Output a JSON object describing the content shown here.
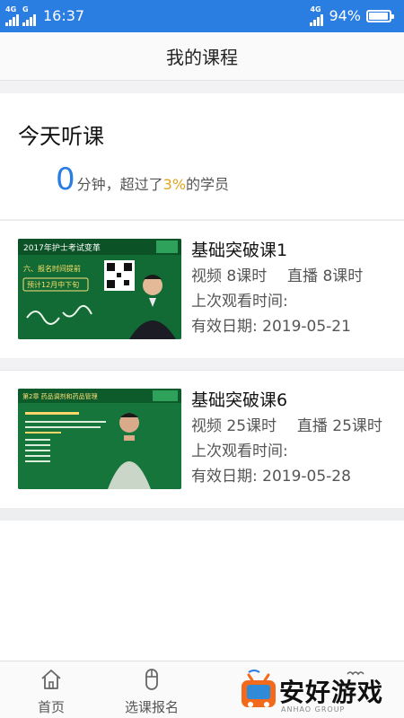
{
  "status_bar": {
    "network_left_1": "4G",
    "network_left_2": "G",
    "time": "16:37",
    "network_right": "4G",
    "battery_text": "94%",
    "battery_level": 0.94
  },
  "header": {
    "title": "我的课程"
  },
  "today": {
    "title": "今天听课",
    "minutes": "0",
    "minutes_unit": "分钟，超过了",
    "percent": "3%",
    "suffix": "的学员"
  },
  "courses": [
    {
      "title": "基础突破课1",
      "video_label": "视频",
      "video_value": "8课时",
      "live_label": "直播",
      "live_value": "8课时",
      "last_watch_label": "上次观看时间:",
      "last_watch_value": "",
      "expiry_label": "有效日期:",
      "expiry_value": "2019-05-21",
      "thumbnail": {
        "headline": "2017年护士考试变革",
        "line_1": "六、报名时间提前",
        "line_2": "预计12月中下旬"
      }
    },
    {
      "title": "基础突破课6",
      "video_label": "视频",
      "video_value": "25课时",
      "live_label": "直播",
      "live_value": "25课时",
      "last_watch_label": "上次观看时间:",
      "last_watch_value": "",
      "expiry_label": "有效日期:",
      "expiry_value": "2019-05-28",
      "thumbnail": {
        "headline": "第2章  药品调剂和药品管理"
      }
    }
  ],
  "bottom_nav": {
    "items": [
      {
        "label": "首页",
        "icon": "home-icon"
      },
      {
        "label": "选课报名",
        "icon": "mouse-icon"
      }
    ]
  },
  "watermark": {
    "text": "安好游戏",
    "sub": "ANHAO GROUP"
  },
  "colors": {
    "accent": "#2a7de1",
    "percent": "#e2a21c"
  }
}
